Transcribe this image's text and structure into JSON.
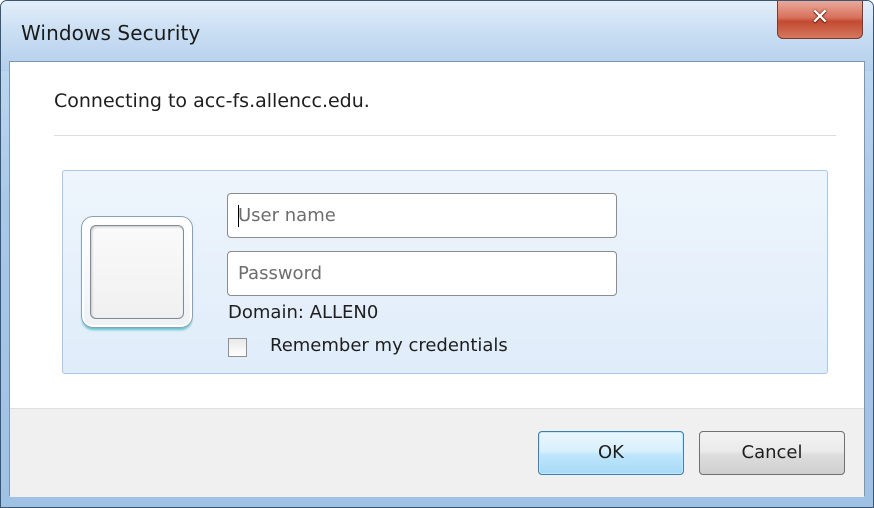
{
  "window": {
    "title": "Windows Security",
    "close_glyph": "✕"
  },
  "dialog": {
    "message": "Connecting to acc-fs.allencc.edu.",
    "username_placeholder": "User name",
    "password_placeholder": "Password",
    "domain_text": "Domain: ALLEN0",
    "remember_label": "Remember my credentials",
    "remember_checked": false
  },
  "buttons": {
    "ok_label": "OK",
    "cancel_label": "Cancel"
  },
  "icons": {
    "close": "close-icon",
    "user_tile": "user-tile-icon"
  },
  "colors": {
    "close_button": "#c24a31",
    "ok_button_border": "#3c7fb1",
    "panel_border": "#a8c8e6"
  }
}
